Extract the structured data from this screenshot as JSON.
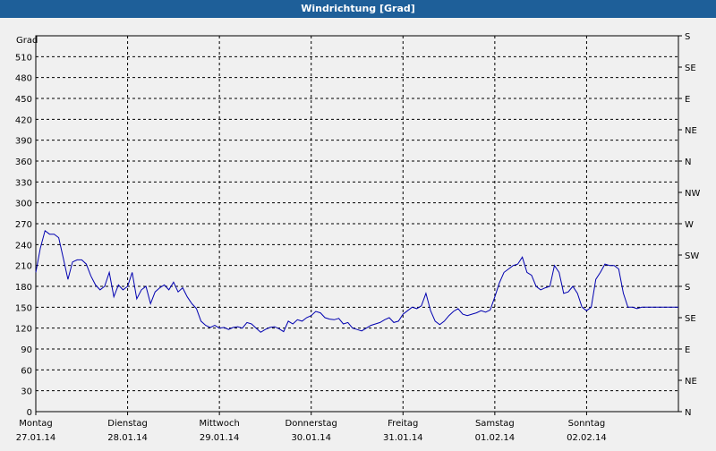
{
  "window": {
    "title": "Windrichtung [Grad]"
  },
  "chart_data": {
    "type": "line",
    "title": "Windrichtung [Grad]",
    "ylabel": "Grad",
    "ylim": [
      0,
      540
    ],
    "y_ticks": [
      0,
      30,
      60,
      90,
      120,
      150,
      180,
      210,
      240,
      270,
      300,
      330,
      360,
      390,
      420,
      450,
      480,
      510
    ],
    "right_axis_labels": [
      "N",
      "NE",
      "E",
      "SE",
      "S",
      "SW",
      "W",
      "NW",
      "N",
      "NE",
      "E",
      "SE",
      "S"
    ],
    "x_day_labels": [
      {
        "day": "Montag",
        "date": "27.01.14"
      },
      {
        "day": "Dienstag",
        "date": "28.01.14"
      },
      {
        "day": "Mittwoch",
        "date": "29.01.14"
      },
      {
        "day": "Donnerstag",
        "date": "30.01.14"
      },
      {
        "day": "Freitag",
        "date": "31.01.14"
      },
      {
        "day": "Samstag",
        "date": "01.02.14"
      },
      {
        "day": "Sonntag",
        "date": "02.02.14"
      }
    ],
    "xlim": [
      "27.01.14 00:00",
      "03.02.14 00:00"
    ],
    "grid": true,
    "line_color": "#0000b0",
    "series": [
      {
        "x_days": [
          0,
          0.05,
          0.1,
          0.15,
          0.2,
          0.25,
          0.3,
          0.35,
          0.4,
          0.45,
          0.5,
          0.55,
          0.6,
          0.65,
          0.7,
          0.75,
          0.8,
          0.85,
          0.9,
          0.95,
          1,
          1.05,
          1.1,
          1.15,
          1.2,
          1.25,
          1.3,
          1.35,
          1.4,
          1.45,
          1.5,
          1.55,
          1.6,
          1.65,
          1.7,
          1.75,
          1.8,
          1.85,
          1.9,
          1.95,
          2,
          2.05,
          2.1,
          2.15,
          2.2,
          2.25,
          2.3,
          2.35,
          2.4,
          2.45,
          2.5,
          2.55,
          2.6,
          2.65,
          2.7,
          2.75,
          2.8,
          2.85,
          2.9,
          2.95,
          3,
          3.05,
          3.1,
          3.15,
          3.2,
          3.25,
          3.3,
          3.35,
          3.4,
          3.45,
          3.5,
          3.55,
          3.6,
          3.65,
          3.7,
          3.75,
          3.8,
          3.85,
          3.9,
          3.95,
          4,
          4.05,
          4.1,
          4.15,
          4.2,
          4.25,
          4.3,
          4.35,
          4.4,
          4.45,
          4.5,
          4.55,
          4.6,
          4.65,
          4.7,
          4.75,
          4.8,
          4.85,
          4.9,
          4.95,
          5,
          5.05,
          5.1,
          5.15,
          5.2,
          5.25,
          5.3,
          5.35,
          5.4,
          5.45,
          5.5,
          5.55,
          5.6,
          5.65,
          5.7,
          5.75,
          5.8,
          5.85,
          5.9,
          5.95,
          6,
          6.05,
          6.1,
          6.15,
          6.2,
          6.25,
          6.3,
          6.35,
          6.4,
          6.45,
          6.5,
          6.55,
          6.6,
          6.65,
          6.7,
          6.75,
          6.8,
          6.85,
          6.9,
          6.95,
          7
        ],
        "values": [
          200,
          235,
          260,
          255,
          255,
          250,
          220,
          190,
          215,
          218,
          218,
          212,
          195,
          182,
          175,
          180,
          200,
          165,
          182,
          175,
          180,
          200,
          162,
          175,
          180,
          155,
          172,
          178,
          182,
          175,
          186,
          172,
          178,
          165,
          155,
          148,
          130,
          124,
          121,
          124,
          120,
          121,
          118,
          121,
          122,
          120,
          128,
          126,
          120,
          114,
          118,
          121,
          122,
          119,
          115,
          130,
          126,
          132,
          130,
          135,
          138,
          144,
          142,
          135,
          133,
          132,
          134,
          126,
          128,
          120,
          118,
          116,
          120,
          124,
          126,
          128,
          132,
          135,
          128,
          130,
          140,
          145,
          150,
          148,
          152,
          170,
          145,
          130,
          125,
          130,
          138,
          144,
          148,
          140,
          138,
          140,
          142,
          145,
          143,
          146,
          165,
          185,
          200,
          205,
          210,
          212,
          222,
          200,
          196,
          180,
          175,
          178,
          180,
          210,
          200,
          170,
          172,
          180,
          170,
          150,
          145,
          150,
          190,
          200,
          212,
          210,
          210,
          205,
          170,
          150,
          150,
          148,
          150,
          150,
          150,
          150,
          150,
          150,
          150,
          150,
          150
        ]
      }
    ]
  }
}
